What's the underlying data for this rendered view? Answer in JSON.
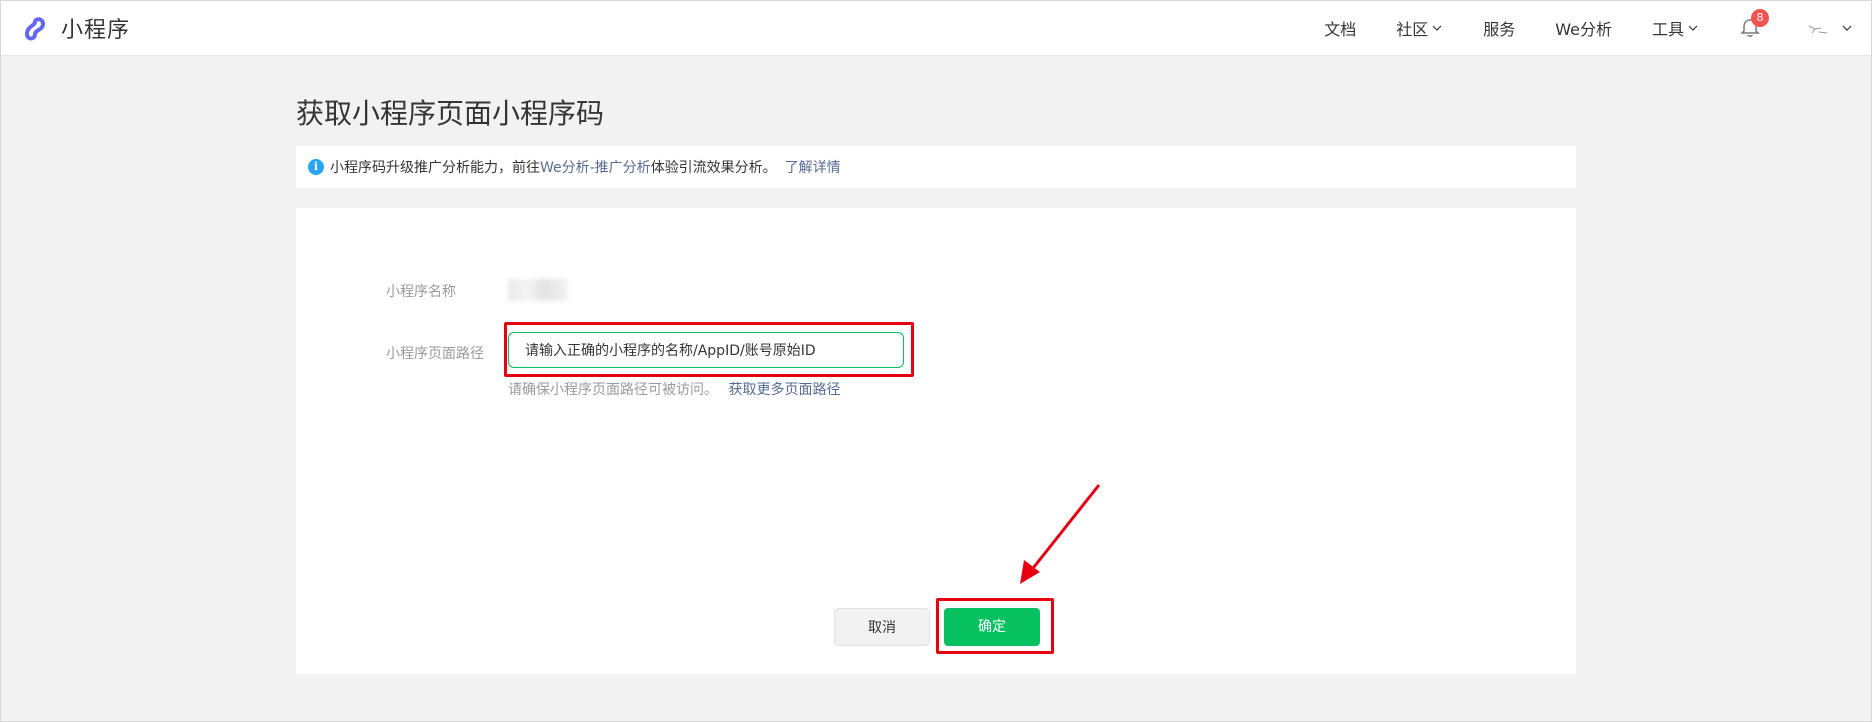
{
  "app": {
    "name": "小程序"
  },
  "nav": {
    "items": [
      {
        "label": "文档",
        "has_dropdown": false
      },
      {
        "label": "社区",
        "has_dropdown": true
      },
      {
        "label": "服务",
        "has_dropdown": false
      },
      {
        "label": "We分析",
        "has_dropdown": false
      },
      {
        "label": "工具",
        "has_dropdown": true
      }
    ],
    "notification_count": "8"
  },
  "page": {
    "title": "获取小程序页面小程序码"
  },
  "notice": {
    "text_before": "小程序码升级推广分析能力，前往",
    "link1": "We分析-推广分析",
    "text_after": "体验引流效果分析。",
    "link2": "了解详情",
    "icon": "info-icon",
    "icon_glyph": "i"
  },
  "form": {
    "name_label": "小程序名称",
    "path_label": "小程序页面路径",
    "path_value": "请输入正确的小程序的名称/AppID/账号原始ID",
    "hint_text": "请确保小程序页面路径可被访问。",
    "hint_link": "获取更多页面路径"
  },
  "actions": {
    "cancel_label": "取消",
    "confirm_label": "确定"
  },
  "colors": {
    "primary": "#07c160",
    "link": "#576b95",
    "highlight": "#e60012",
    "badge": "#fa5151",
    "info": "#2aa4f4",
    "logo": "#6467f0"
  }
}
